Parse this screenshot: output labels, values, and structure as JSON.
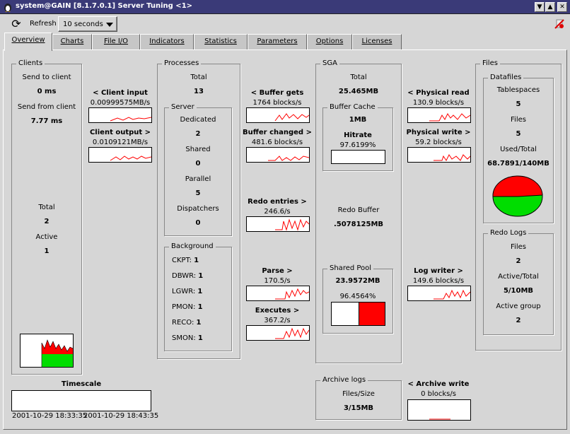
{
  "window": {
    "title": "system@GAIN [8.1.7.0.1] Server Tuning <1>",
    "min": "▼",
    "max": "▲",
    "close": "✕"
  },
  "toolbar": {
    "refresh_label": "Refresh",
    "interval": "10 seconds"
  },
  "tabs": [
    "Overview",
    "Charts",
    "File I/O",
    "Indicators",
    "Statistics",
    "Parameters",
    "Options",
    "Licenses"
  ],
  "clients": {
    "title": "Clients",
    "send_to_label": "Send to client",
    "send_to_value": "0 ms",
    "send_from_label": "Send from client",
    "send_from_value": "7.77 ms",
    "total_label": "Total",
    "total_value": "2",
    "active_label": "Active",
    "active_value": "1"
  },
  "client_io": {
    "input_label": "< Client input",
    "input_value": "0.00999575MB/s",
    "output_label": "Client output >",
    "output_value": "0.0109121MB/s"
  },
  "timescale": {
    "label": "Timescale",
    "start": "2001-10-29 18:33:35",
    "end": "2001-10-29 18:43:35"
  },
  "processes": {
    "title": "Processes",
    "total_label": "Total",
    "total_value": "13",
    "server": {
      "title": "Server",
      "dedicated_label": "Dedicated",
      "dedicated_value": "2",
      "shared_label": "Shared",
      "shared_value": "0",
      "parallel_label": "Parallel",
      "parallel_value": "5",
      "dispatchers_label": "Dispatchers",
      "dispatchers_value": "0"
    },
    "background": {
      "title": "Background",
      "items": [
        {
          "name": "CKPT:",
          "value": "1"
        },
        {
          "name": "DBWR:",
          "value": "1"
        },
        {
          "name": "LGWR:",
          "value": "1"
        },
        {
          "name": "PMON:",
          "value": "1"
        },
        {
          "name": "RECO:",
          "value": "1"
        },
        {
          "name": "SMON:",
          "value": "1"
        }
      ]
    }
  },
  "rates": {
    "buffer_gets_label": "< Buffer gets",
    "buffer_gets_value": "1764 blocks/s",
    "buffer_changed_label": "Buffer changed >",
    "buffer_changed_value": "481.6 blocks/s",
    "redo_entries_label": "Redo entries >",
    "redo_entries_value": "246.6/s",
    "parse_label": "Parse >",
    "parse_value": "170.5/s",
    "executes_label": "Executes >",
    "executes_value": "367.2/s"
  },
  "sga": {
    "title": "SGA",
    "total_label": "Total",
    "total_value": "25.465MB",
    "buffer_cache": {
      "title": "Buffer Cache",
      "size": "1MB",
      "hitrate_label": "Hitrate",
      "hitrate_value": "97.6199%",
      "hitrate_fraction": 0.976
    },
    "redo_buffer_label": "Redo Buffer",
    "redo_buffer_value": ".5078125MB",
    "shared_pool": {
      "title": "Shared Pool",
      "size": "23.9572MB",
      "usage_value": "96.4564%",
      "usage_fraction": 0.5
    },
    "archive": {
      "title": "Archive logs",
      "files_size_label": "Files/Size",
      "files_size_value": "3/15MB"
    }
  },
  "physical": {
    "read_label": "< Physical read",
    "read_value": "130.9 blocks/s",
    "write_label": "Physical write >",
    "write_value": "59.2 blocks/s",
    "log_writer_label": "Log writer >",
    "log_writer_value": "149.6 blocks/s",
    "archive_write_label": "< Archive write",
    "archive_write_value": "0 blocks/s"
  },
  "files": {
    "title": "Files",
    "datafiles": {
      "title": "Datafiles",
      "tablespaces_label": "Tablespaces",
      "tablespaces_value": "5",
      "files_label": "Files",
      "files_value": "5",
      "used_total_label": "Used/Total",
      "used_total_value": "68.7891/140MB"
    },
    "redo_logs": {
      "title": "Redo Logs",
      "files_label": "Files",
      "files_value": "2",
      "active_total_label": "Active/Total",
      "active_total_value": "5/10MB",
      "active_group_label": "Active group",
      "active_group_value": "2"
    }
  },
  "colors": {
    "used": "#ff0000",
    "free": "#00dd00",
    "title_bg": "#3a3a78",
    "panel": "#d6d6d6"
  },
  "icons": {
    "app": "tux-icon",
    "refresh": "refresh-icon",
    "exit": "exit-icon"
  }
}
